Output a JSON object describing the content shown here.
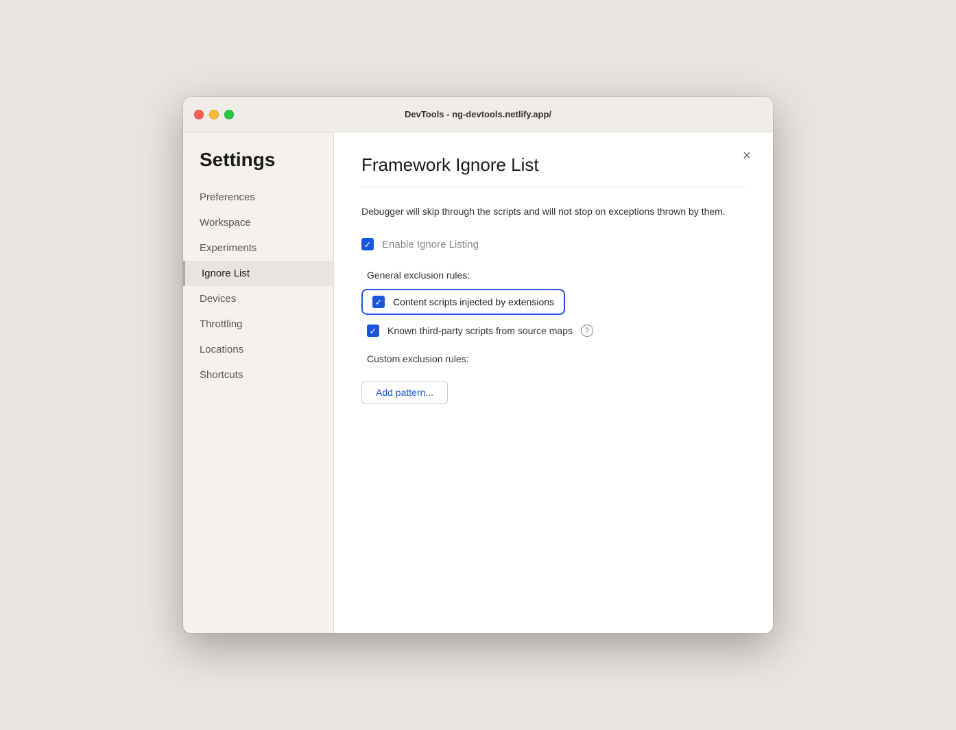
{
  "titlebar": {
    "title": "DevTools - ng-devtools.netlify.app/"
  },
  "sidebar": {
    "heading": "Settings",
    "items": [
      {
        "id": "preferences",
        "label": "Preferences",
        "active": false
      },
      {
        "id": "workspace",
        "label": "Workspace",
        "active": false
      },
      {
        "id": "experiments",
        "label": "Experiments",
        "active": false
      },
      {
        "id": "ignore-list",
        "label": "Ignore List",
        "active": true
      },
      {
        "id": "devices",
        "label": "Devices",
        "active": false
      },
      {
        "id": "throttling",
        "label": "Throttling",
        "active": false
      },
      {
        "id": "locations",
        "label": "Locations",
        "active": false
      },
      {
        "id": "shortcuts",
        "label": "Shortcuts",
        "active": false
      }
    ]
  },
  "main": {
    "title": "Framework Ignore List",
    "description": "Debugger will skip through the scripts and will not stop on exceptions thrown by them.",
    "enable_ignore_listing_label": "Enable Ignore Listing",
    "general_exclusion_label": "General exclusion rules:",
    "content_scripts_label": "Content scripts injected by extensions",
    "known_scripts_label": "Known third-party scripts from source maps",
    "custom_exclusion_label": "Custom exclusion rules:",
    "add_pattern_label": "Add pattern...",
    "close_icon": "×"
  }
}
